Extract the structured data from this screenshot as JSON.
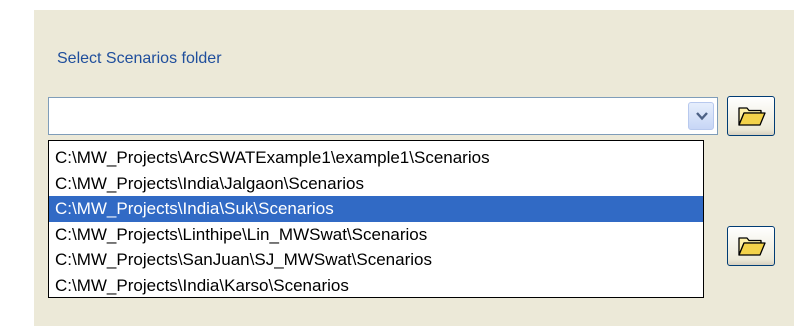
{
  "scenarios": {
    "label": "Select Scenarios folder",
    "selected_value": "",
    "dropdown_arrow_icon": "chevron-down-icon",
    "browse_icon": "open-folder-icon",
    "options": [
      "C:\\MW_Projects\\ArcSWATExample1\\example1\\Scenarios",
      "C:\\MW_Projects\\India\\Jalgaon\\Scenarios",
      "C:\\MW_Projects\\India\\Suk\\Scenarios",
      "C:\\MW_Projects\\Linthipe\\Lin_MWSwat\\Scenarios",
      "C:\\MW_Projects\\SanJuan\\SJ_MWSwat\\Scenarios",
      "C:\\MW_Projects\\India\\Karso\\Scenarios"
    ],
    "highlighted_index": 2
  },
  "colors": {
    "panel_background": "#ece9d8",
    "label_text": "#1f4e9c",
    "highlight": "#316ac5"
  }
}
